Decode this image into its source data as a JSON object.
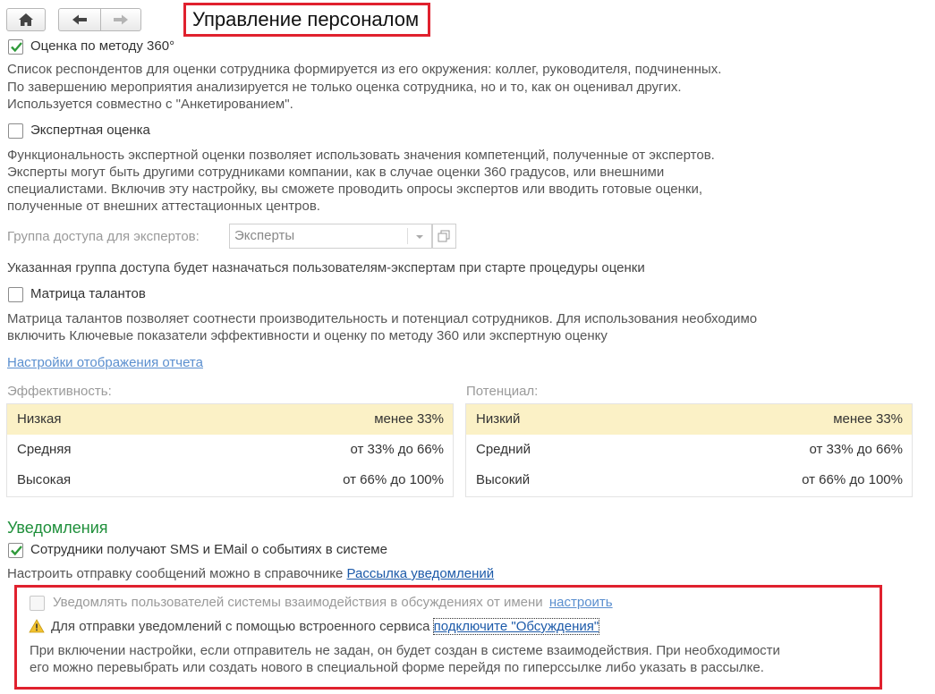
{
  "header": {
    "title": "Управление персоналом",
    "home_icon": "home-icon",
    "back_icon": "arrow-left-icon",
    "forward_icon": "arrow-right-icon"
  },
  "assessment_360": {
    "label": "Оценка по методу 360°",
    "checked": true,
    "description": [
      "Список респондентов для оценки сотрудника формируется из его окружения: коллег, руководителя, подчиненных.",
      "По завершению мероприятия анализируется не только оценка сотрудника, но и то, как он оценивал других.",
      "Используется совместно с \"Анкетированием\"."
    ]
  },
  "expert_assessment": {
    "label": "Экспертная оценка",
    "checked": false,
    "description": [
      "Функциональность экспертной оценки позволяет использовать значения компетенций, полученные от экспертов.",
      "Эксперты могут быть другими сотрудниками компании, как в случае оценки 360 градусов, или внешними",
      "специалистами. Включив эту настройку, вы сможете проводить опросы экспертов или вводить готовые оценки,",
      "полученные от внешних аттестационных центров."
    ],
    "access_group_label": "Группа доступа для экспертов:",
    "access_group_value": "Эксперты",
    "access_group_note": "Указанная группа доступа будет назначаться пользователям-экспертам при старте процедуры оценки"
  },
  "talent_matrix": {
    "label": "Матрица талантов",
    "checked": false,
    "description": [
      "Матрица талантов позволяет соотнести производительность и потенциал сотрудников. Для использования необходимо",
      "включить Ключевые показатели эффективности и оценку по методу 360 или экспертную оценку"
    ],
    "report_settings_link": "Настройки отображения отчета"
  },
  "efficiency": {
    "caption": "Эффективность:",
    "rows": [
      {
        "name": "Низкая",
        "range": "менее 33%"
      },
      {
        "name": "Средняя",
        "range": "от 33% до 66%"
      },
      {
        "name": "Высокая",
        "range": "от 66% до 100%"
      }
    ]
  },
  "potential": {
    "caption": "Потенциал:",
    "rows": [
      {
        "name": "Низкий",
        "range": "менее 33%"
      },
      {
        "name": "Средний",
        "range": "от 33% до 66%"
      },
      {
        "name": "Высокий",
        "range": "от 66% до 100%"
      }
    ]
  },
  "notifications": {
    "title": "Уведомления",
    "sms_label": "Сотрудники получают SMS и EMail о событиях в системе",
    "sms_checked": true,
    "setup_text": "Настроить отправку сообщений можно в справочнике",
    "setup_link": "Рассылка уведомлений",
    "discussions_label": "Уведомлять пользователей системы взаимодействия в обсуждениях от имени",
    "discussions_link": "настроить",
    "warning_icon": "warning-icon",
    "warning_text": "Для отправки уведомлений с помощью встроенного сервиса",
    "warning_link": "подключите \"Обсуждения\"",
    "info": [
      "При включении настройки, если отправитель не задан, он будет создан в системе взаимодействия. При необходимости",
      "его можно перевыбрать или создать нового в специальной форме перейдя по гиперссылке либо указать в рассылке."
    ]
  },
  "colors": {
    "accent_red": "#e0212e",
    "section_green": "#1e8f3a",
    "link_blue": "#1c5aa9",
    "selected_row": "#fbf1c6",
    "checkmark_green": "#2f9a3a"
  }
}
